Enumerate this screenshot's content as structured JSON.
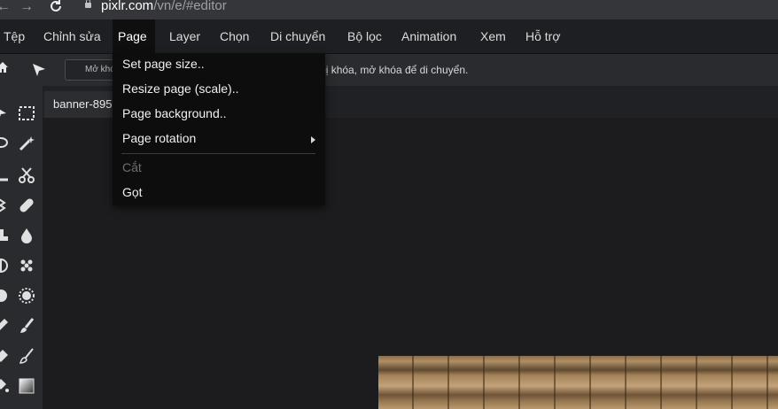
{
  "browser": {
    "url_host": "pixlr.com",
    "url_path": "/vn/e/#editor"
  },
  "menubar": {
    "items": [
      {
        "label": "Tệp"
      },
      {
        "label": "Chỉnh sửa"
      },
      {
        "label": "Page"
      },
      {
        "label": "Layer"
      },
      {
        "label": "Chọn"
      },
      {
        "label": "Di chuyển"
      },
      {
        "label": "Bộ lọc"
      },
      {
        "label": "Animation"
      },
      {
        "label": "Xem"
      },
      {
        "label": "Hỗ trợ"
      }
    ],
    "active": "Page"
  },
  "page_menu": {
    "items": [
      {
        "label": "Set page size..",
        "enabled": true
      },
      {
        "label": "Resize page (scale)..",
        "enabled": true
      },
      {
        "label": "Page background..",
        "enabled": true
      },
      {
        "label": "Page rotation",
        "enabled": true,
        "submenu": true
      },
      {
        "label": "Cắt",
        "enabled": false
      },
      {
        "label": "Gọt",
        "enabled": true
      }
    ]
  },
  "options": {
    "unlock_button_label": "Mở khóa layer để di chuyển",
    "hint": "Vị trí layer đã bị khóa, mở khóa để di chuyển."
  },
  "document": {
    "tab_label": "banner-895573-1280.jpg"
  },
  "icons": [
    "back-icon",
    "forward-icon",
    "reload-icon",
    "lock-icon",
    "home-icon",
    "arrange-tool-icon",
    "marquee-tool-icon",
    "lasso-tool-icon",
    "magic-wand-icon",
    "crop-tool-icon",
    "scissors-icon",
    "liquify-icon",
    "heal-icon",
    "stamp-icon",
    "drop-icon",
    "dodge-icon",
    "sponge-icon",
    "blur-icon",
    "focus-icon",
    "pen-icon",
    "brush-icon",
    "eraser-icon",
    "gradient-icon",
    "submenu-arrow-icon",
    "close-icon"
  ]
}
